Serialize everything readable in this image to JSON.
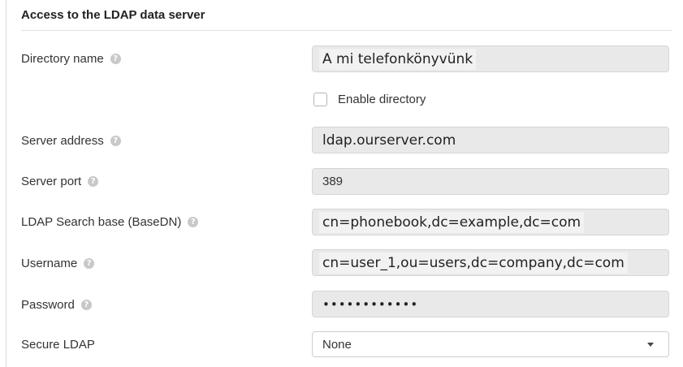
{
  "section": {
    "title": "Access to the LDAP data server"
  },
  "fields": {
    "directory_name": {
      "label": "Directory name",
      "value": "A mi telefonkönyvünk"
    },
    "enable_directory": {
      "label": "Enable directory",
      "checked": false
    },
    "server_address": {
      "label": "Server address",
      "value": "ldap.ourserver.com"
    },
    "server_port": {
      "label": "Server port",
      "value": "389"
    },
    "search_base": {
      "label": "LDAP Search base (BaseDN)",
      "value": "cn=phonebook,dc=example,dc=com"
    },
    "username": {
      "label": "Username",
      "value": "cn=user_1,ou=users,dc=company,dc=com"
    },
    "password": {
      "label": "Password",
      "value": "••••••••••••"
    },
    "secure_ldap": {
      "label": "Secure LDAP",
      "selected": "None"
    }
  },
  "help_icon_glyph": "?",
  "icons": {
    "help": "question-circle-icon",
    "dropdown": "caret-down-icon"
  }
}
